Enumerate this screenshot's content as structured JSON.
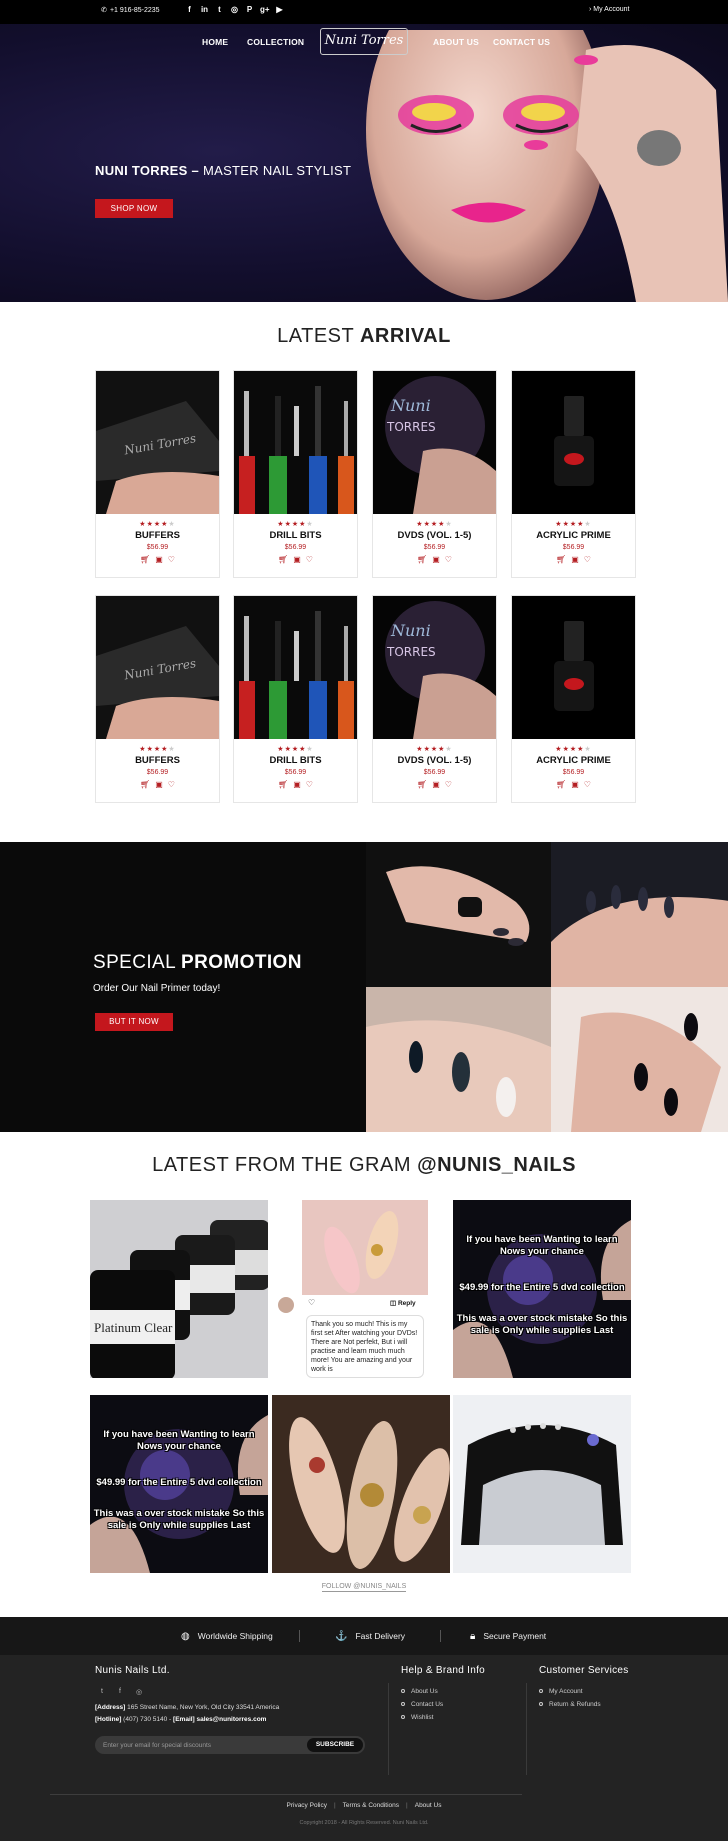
{
  "topbar": {
    "phone": "+1 916-85-2235",
    "social_icons": [
      "facebook-icon",
      "linkedin-icon",
      "twitter-icon",
      "instagram-icon",
      "pinterest-icon",
      "google-plus-icon",
      "youtube-icon"
    ],
    "account": "My Account"
  },
  "nav": {
    "home": "HOME",
    "collection": "COLLECTION",
    "about": "ABOUT US",
    "contact": "CONTACT US",
    "logo": "Nuni Torres"
  },
  "hero": {
    "title_bold": "NUNI TORRES –",
    "title_rest": " MASTER NAIL STYLIST",
    "button": "SHOP NOW"
  },
  "arrival": {
    "title_light": "LATEST ",
    "title_bold": "ARRIVAL",
    "products": [
      {
        "name": "BUFFERS",
        "price": "$56.99",
        "rating": 4
      },
      {
        "name": "DRILL BITS",
        "price": "$56.99",
        "rating": 4
      },
      {
        "name": "DVDS (VOL. 1-5)",
        "price": "$56.99",
        "rating": 4
      },
      {
        "name": "ACRYLIC PRIME",
        "price": "$56.99",
        "rating": 4
      },
      {
        "name": "BUFFERS",
        "price": "$56.99",
        "rating": 4
      },
      {
        "name": "DRILL BITS",
        "price": "$56.99",
        "rating": 4
      },
      {
        "name": "DVDS (VOL. 1-5)",
        "price": "$56.99",
        "rating": 4
      },
      {
        "name": "ACRYLIC PRIME",
        "price": "$56.99",
        "rating": 4
      }
    ]
  },
  "promo": {
    "title_light": "SPECIAL ",
    "title_bold": "PROMOTION",
    "subtitle": "Order Our Nail Primer today!",
    "button": "BUT IT NOW"
  },
  "gram": {
    "title_light": "LATEST FROM THE GRAM ",
    "title_bold": "@NUNIS_NAILS",
    "comment": "Thank you so much! This is my first set After watching your DVDs! There are Not perfekt, But i will practise and learn much much more! You are amazing and your work is",
    "reply": "Reply",
    "promo_text_top": "If you have been Wanting to learn Nows your chance",
    "promo_text_mid": "$49.99 for the Entire 5 dvd collection",
    "promo_text_bot": "This was a over stock mistake So this sale is Only while supplies Last",
    "follow": "FOLLOW @NUNIS_NAILS"
  },
  "features": [
    "Worldwide Shipping",
    "Fast Delivery",
    "Secure Payment"
  ],
  "footer": {
    "company": "Nunis Nails Ltd.",
    "address_label": "[Address]",
    "address": " 165 Street Name, New York,  Old City 33541 America",
    "hotline_label": "[Hotline]",
    "hotline": " (407) 730 5140 - ",
    "email_label": "[Email]",
    "email": " sales@nunitorres.com",
    "subscribe_placeholder": "Enter your email for special discounts",
    "subscribe_button": "SUBSCRIBE",
    "help_title": "Help & Brand Info",
    "help_items": [
      "About Us",
      "Contact Us",
      "Wishlist"
    ],
    "cs_title": "Customer Services",
    "cs_items": [
      "My Account",
      "Return & Refunds"
    ],
    "links": [
      "Privacy Policy",
      "Terms & Conditions",
      "About Us"
    ],
    "copyright": "Copyright 2018 - All Rights Reserved. Nuni Nails Ltd."
  },
  "colors": {
    "accent": "#c4171d",
    "footer_bg": "#232323",
    "hero_bg": "#130f2e"
  }
}
